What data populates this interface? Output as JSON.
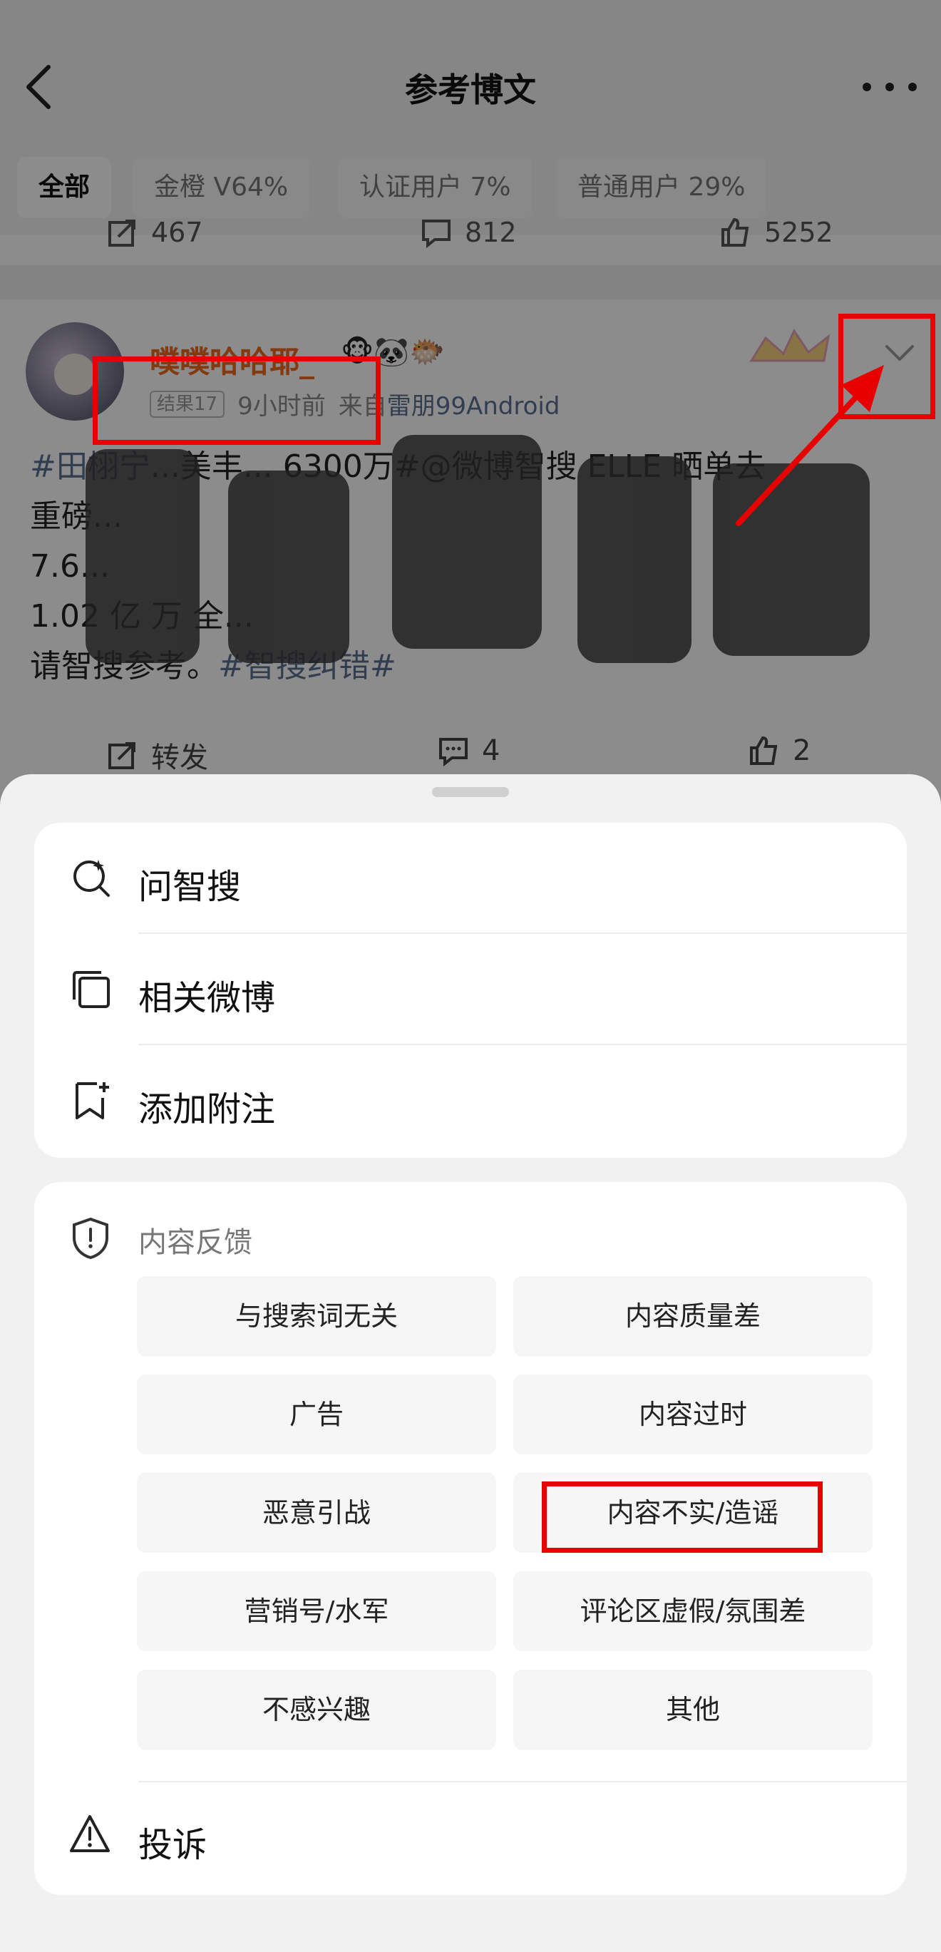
{
  "nav": {
    "title": "参考博文"
  },
  "filters": [
    {
      "label": "全部"
    },
    {
      "label": "金橙 V64%"
    },
    {
      "label": "认证用户 7%"
    },
    {
      "label": "普通用户 29%"
    }
  ],
  "prev_post_actions": {
    "repost": "467",
    "comments": "812",
    "likes": "5252"
  },
  "post": {
    "username": "噗噗哈哈耶_",
    "badges": "🐵🐼🐡",
    "result_tag": "结果17",
    "time": "9小时前",
    "source_prefix": "来自",
    "source_name": "雷朋99Android",
    "text_lines": [
      {
        "hashtag": "#田栩宁",
        "rest": "...美丰... 6300万#@微博智搜 ELLE 晒单去"
      },
      {
        "hashtag": "",
        "rest": "重磅..."
      },
      {
        "hashtag": "",
        "rest": "7.6..."
      },
      {
        "hashtag": "",
        "rest": "1.02 亿 万 全..."
      },
      {
        "hashtag": "#智搜纠错#",
        "rest": "请智搜参考。"
      }
    ],
    "repost_label": "转发",
    "comments": "4",
    "likes": "2"
  },
  "sheet": {
    "menu": [
      {
        "label": "问智搜",
        "icon": "search-ai-icon"
      },
      {
        "label": "相关微博",
        "icon": "stack-icon"
      },
      {
        "label": "添加附注",
        "icon": "bookmark-add-icon"
      }
    ],
    "feedback_title": "内容反馈",
    "feedback_options": [
      "与搜索词无关",
      "内容质量差",
      "广告",
      "内容过时",
      "恶意引战",
      "内容不实/造谣",
      "营销号/水军",
      "评论区虚假/氛围差",
      "不感兴趣",
      "其他"
    ],
    "report_label": "投诉"
  },
  "colors": {
    "accent_user": "#f06a1f",
    "annotation": "#e80000",
    "link": "#5d6f93"
  }
}
